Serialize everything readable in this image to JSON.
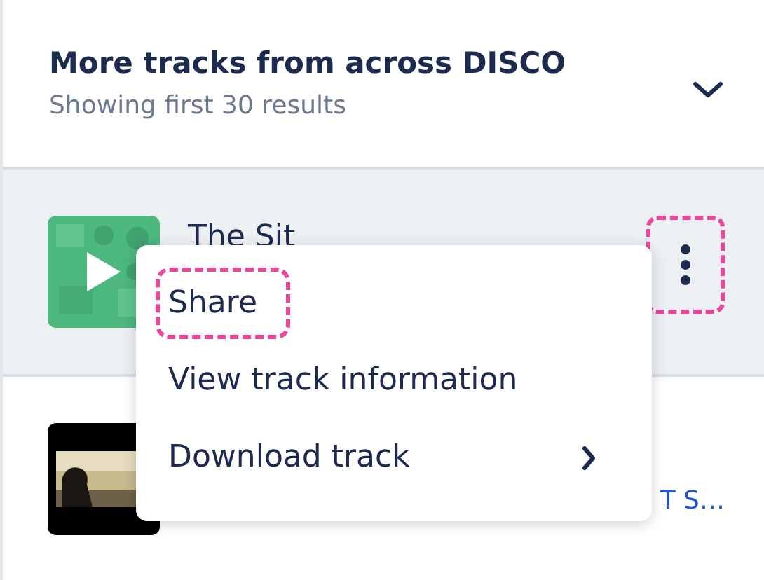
{
  "section": {
    "title": "More tracks from across DISCO",
    "subtitle": "Showing first 30 results",
    "expanded": false
  },
  "tracks": [
    {
      "title": "The Sit",
      "selected": true,
      "more_button": {
        "highlighted": true
      }
    },
    {
      "link": "T S…",
      "selected": false
    }
  ],
  "menu": {
    "items": [
      {
        "label": "Share",
        "highlighted": true,
        "submenu": false
      },
      {
        "label": "View track information",
        "highlighted": false,
        "submenu": false
      },
      {
        "label": "Download track",
        "highlighted": false,
        "submenu": true
      }
    ]
  }
}
